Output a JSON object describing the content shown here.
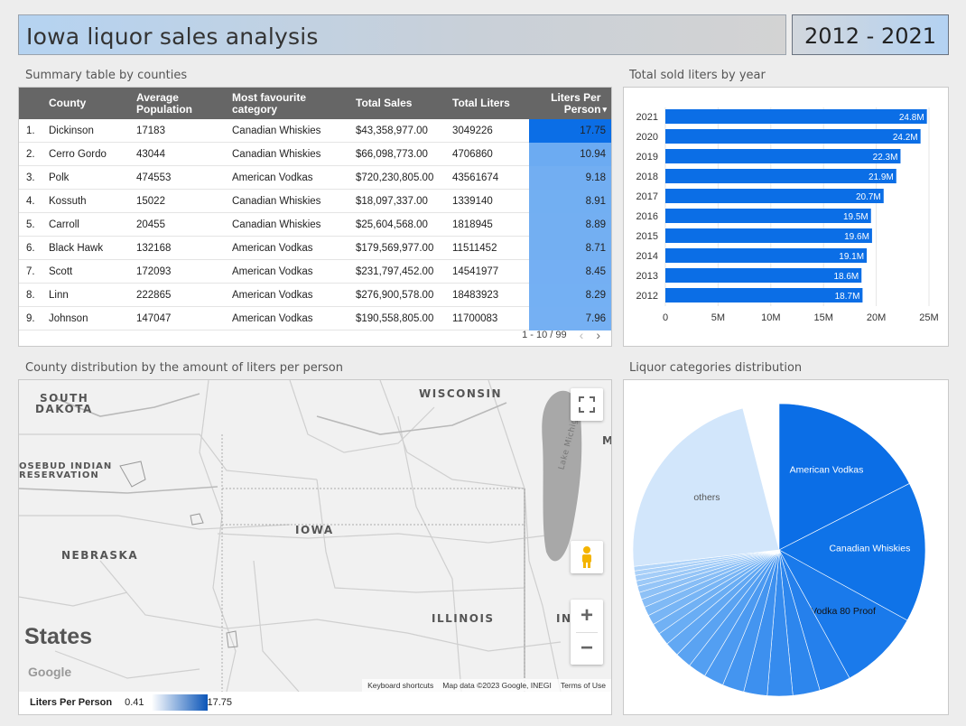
{
  "header": {
    "title": "Iowa liquor sales analysis",
    "date_range": "2012 - 2021"
  },
  "summary": {
    "title": "Summary table by counties",
    "columns": [
      "County",
      "Average Population",
      "Most favourite category",
      "Total Sales",
      "Total Liters",
      "Liters Per Person"
    ],
    "sort_indicator": "▾",
    "rows": [
      {
        "n": "1.",
        "county": "Dickinson",
        "pop": "17183",
        "cat": "Canadian Whiskies",
        "sales": "$43,358,977.00",
        "liters": "3049226",
        "lpp": "17.75",
        "lpp_v": 17.75
      },
      {
        "n": "2.",
        "county": "Cerro Gordo",
        "pop": "43044",
        "cat": "Canadian Whiskies",
        "sales": "$66,098,773.00",
        "liters": "4706860",
        "lpp": "10.94",
        "lpp_v": 10.94
      },
      {
        "n": "3.",
        "county": "Polk",
        "pop": "474553",
        "cat": "American Vodkas",
        "sales": "$720,230,805.00",
        "liters": "43561674",
        "lpp": "9.18",
        "lpp_v": 9.18
      },
      {
        "n": "4.",
        "county": "Kossuth",
        "pop": "15022",
        "cat": "Canadian Whiskies",
        "sales": "$18,097,337.00",
        "liters": "1339140",
        "lpp": "8.91",
        "lpp_v": 8.91
      },
      {
        "n": "5.",
        "county": "Carroll",
        "pop": "20455",
        "cat": "Canadian Whiskies",
        "sales": "$25,604,568.00",
        "liters": "1818945",
        "lpp": "8.89",
        "lpp_v": 8.89
      },
      {
        "n": "6.",
        "county": "Black Hawk",
        "pop": "132168",
        "cat": "American Vodkas",
        "sales": "$179,569,977.00",
        "liters": "11511452",
        "lpp": "8.71",
        "lpp_v": 8.71
      },
      {
        "n": "7.",
        "county": "Scott",
        "pop": "172093",
        "cat": "American Vodkas",
        "sales": "$231,797,452.00",
        "liters": "14541977",
        "lpp": "8.45",
        "lpp_v": 8.45
      },
      {
        "n": "8.",
        "county": "Linn",
        "pop": "222865",
        "cat": "American Vodkas",
        "sales": "$276,900,578.00",
        "liters": "18483923",
        "lpp": "8.29",
        "lpp_v": 8.29
      },
      {
        "n": "9.",
        "county": "Johnson",
        "pop": "147047",
        "cat": "American Vodkas",
        "sales": "$190,558,805.00",
        "liters": "11700083",
        "lpp": "7.96",
        "lpp_v": 7.96
      }
    ],
    "pager": "1 - 10 / 99"
  },
  "liters_by_year": {
    "title": "Total sold liters by year"
  },
  "map": {
    "title": "County distribution by the amount of liters per person",
    "labels": {
      "south_dakota_1": "SOUTH",
      "south_dakota_2": "DAKOTA",
      "wisconsin": "WISCONSIN",
      "rosebud_1": "OSEBUD INDIAN",
      "rosebud_2": "RESERVATION",
      "iowa": "IOWA",
      "nebraska": "NEBRASKA",
      "illinois": "ILLINOIS",
      "indiana": "INI",
      "michigan": "M",
      "lake": "Lake Michigan",
      "states": "States",
      "google": "Google"
    },
    "attribution": {
      "shortcuts": "Keyboard shortcuts",
      "data": "Map data ©2023 Google, INEGI",
      "terms": "Terms of Use"
    },
    "legend": {
      "label": "Liters Per Person",
      "min": "0.41",
      "max": "17.75"
    }
  },
  "categories": {
    "title": "Liquor categories distribution",
    "labels": {
      "a": "American Vodkas",
      "b": "Canadian Whiskies",
      "c": "Vodka 80 Proof",
      "others": "others"
    }
  },
  "chart_data": [
    {
      "type": "bar",
      "orientation": "horizontal",
      "categories": [
        "2021",
        "2020",
        "2019",
        "2018",
        "2017",
        "2016",
        "2015",
        "2014",
        "2013",
        "2012"
      ],
      "values": [
        24.8,
        24.2,
        22.3,
        21.9,
        20.7,
        19.5,
        19.6,
        19.1,
        18.6,
        18.7
      ],
      "value_labels": [
        "24.8M",
        "24.2M",
        "22.3M",
        "21.9M",
        "20.7M",
        "19.5M",
        "19.6M",
        "19.1M",
        "18.6M",
        "18.7M"
      ],
      "title": "Total sold liters by year",
      "xlim": [
        0,
        25
      ],
      "xticks": [
        "0",
        "5M",
        "10M",
        "15M",
        "20M",
        "25M"
      ],
      "grid": true,
      "color": "#0b6ee6"
    },
    {
      "type": "pie",
      "title": "Liquor categories distribution",
      "slices": [
        {
          "label": "American Vodkas",
          "share": 0.175,
          "color": "#0b6ee6"
        },
        {
          "label": "Canadian Whiskies",
          "share": 0.155,
          "color": "#0f73e8"
        },
        {
          "label": "Vodka 80 Proof",
          "share": 0.09,
          "color": "#1a7aeb"
        },
        {
          "label": "",
          "share": 0.035,
          "color": "#2580ec"
        },
        {
          "label": "",
          "share": 0.03,
          "color": "#2d86ed"
        },
        {
          "label": "",
          "share": 0.028,
          "color": "#358bee"
        },
        {
          "label": "",
          "share": 0.026,
          "color": "#3d90ef"
        },
        {
          "label": "",
          "share": 0.024,
          "color": "#4495f0"
        },
        {
          "label": "",
          "share": 0.022,
          "color": "#4c9af1"
        },
        {
          "label": "",
          "share": 0.02,
          "color": "#539ff2"
        },
        {
          "label": "",
          "share": 0.018,
          "color": "#5aa3f2"
        },
        {
          "label": "",
          "share": 0.016,
          "color": "#62a8f3"
        },
        {
          "label": "",
          "share": 0.014,
          "color": "#69adf4"
        },
        {
          "label": "",
          "share": 0.012,
          "color": "#71b1f4"
        },
        {
          "label": "",
          "share": 0.011,
          "color": "#78b5f5"
        },
        {
          "label": "",
          "share": 0.01,
          "color": "#7fb9f5"
        },
        {
          "label": "",
          "share": 0.009,
          "color": "#87bdf6"
        },
        {
          "label": "",
          "share": 0.008,
          "color": "#8ec1f6"
        },
        {
          "label": "",
          "share": 0.007,
          "color": "#95c5f7"
        },
        {
          "label": "",
          "share": 0.006,
          "color": "#9cc9f7"
        },
        {
          "label": "",
          "share": 0.006,
          "color": "#a4cdf8"
        },
        {
          "label": "",
          "share": 0.005,
          "color": "#abd1f8"
        },
        {
          "label": "",
          "share": 0.005,
          "color": "#b2d5f9"
        },
        {
          "label": "others",
          "share": 0.228,
          "color": "#d2e6fb"
        }
      ]
    }
  ]
}
